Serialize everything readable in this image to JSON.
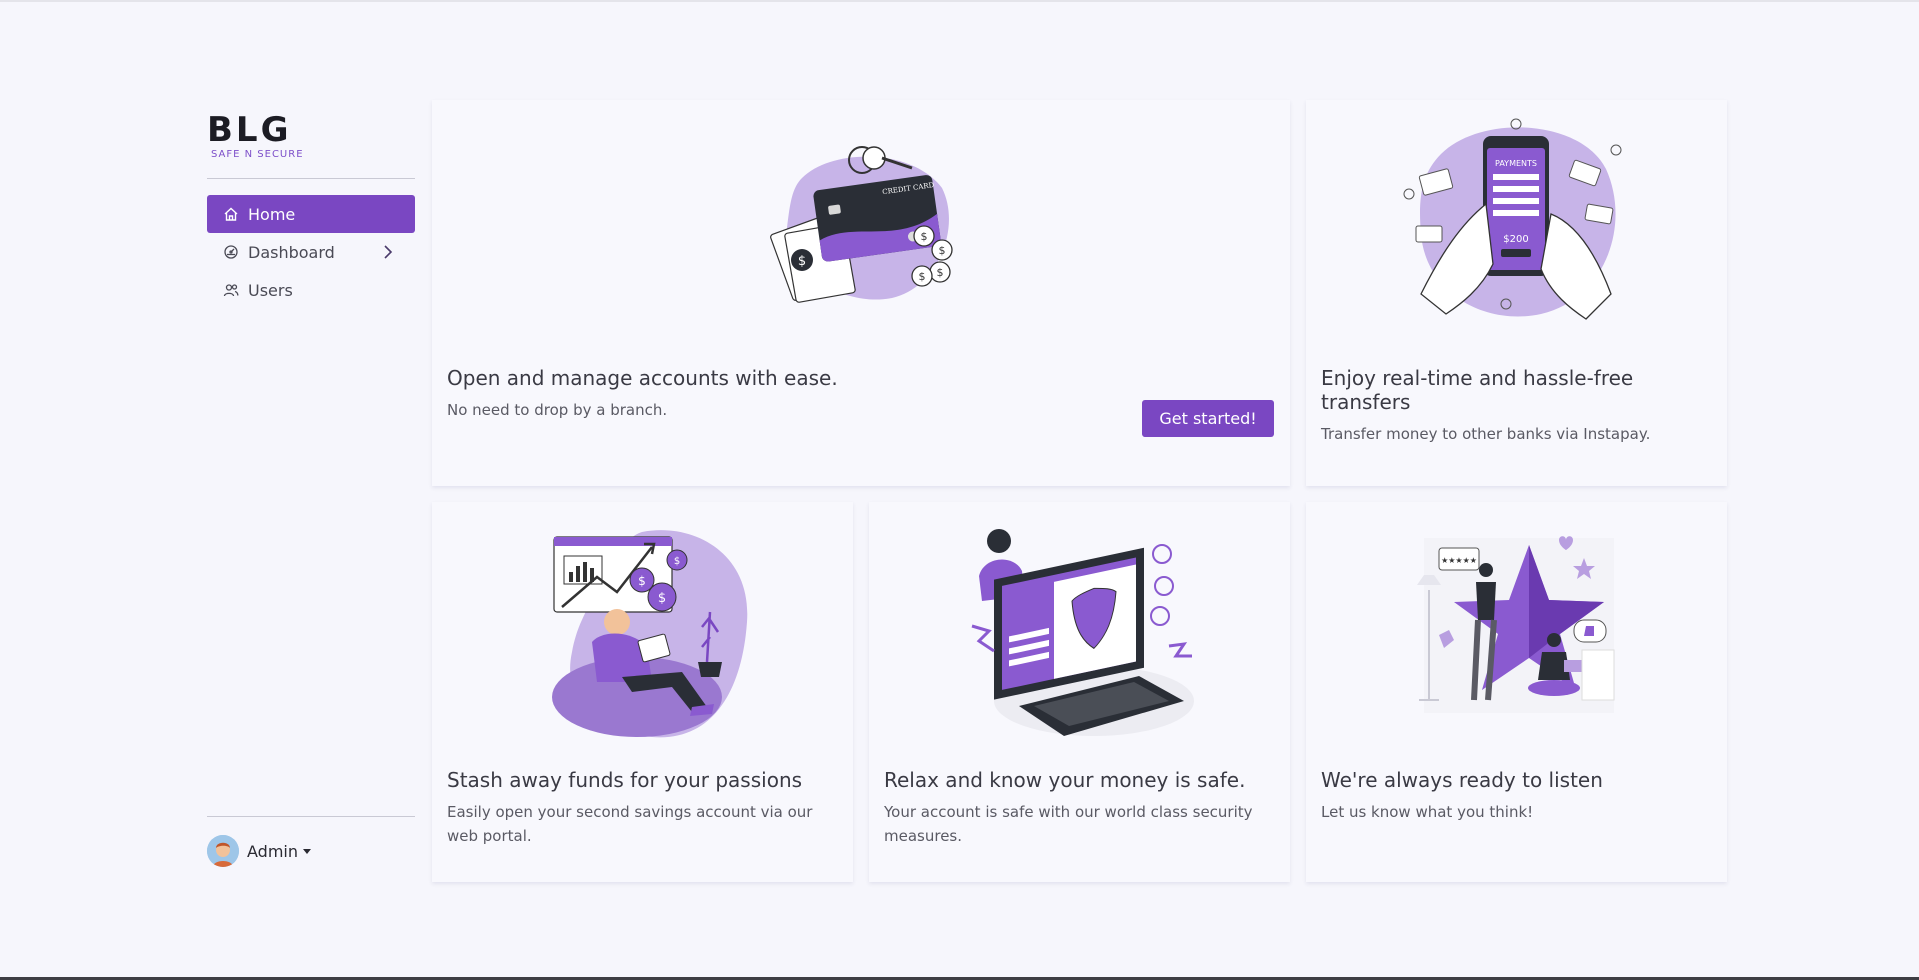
{
  "brand": {
    "logo_text": "BLG",
    "tagline": "SAFE N SECURE"
  },
  "sidebar": {
    "items": [
      {
        "label": "Home",
        "icon": "home-icon",
        "active": true
      },
      {
        "label": "Dashboard",
        "icon": "dashboard-icon",
        "expandable": true
      },
      {
        "label": "Users",
        "icon": "users-icon"
      }
    ],
    "user": {
      "name": "Admin"
    }
  },
  "cards": [
    {
      "title": "Open and manage accounts with ease.",
      "subtitle": "No need to drop by a branch.",
      "button": "Get started!",
      "illustration": "credit-card-illustration"
    },
    {
      "title": "Enjoy real-time and hassle-free transfers",
      "subtitle": "Transfer money to other banks via Instapay.",
      "illustration": "payments-phone-illustration"
    },
    {
      "title": "Stash away funds for your passions",
      "subtitle": "Easily open your second savings account via our web portal.",
      "illustration": "savings-illustration"
    },
    {
      "title": "Relax and know your money is safe.",
      "subtitle": "Your account is safe with our world class security measures.",
      "illustration": "security-illustration"
    },
    {
      "title": "We're always ready to listen",
      "subtitle": "Let us know what you think!",
      "illustration": "feedback-illustration"
    }
  ],
  "colors": {
    "accent": "#7a47c2",
    "background": "#f6f6fc",
    "illustration_purple": "#c7b4e8"
  }
}
